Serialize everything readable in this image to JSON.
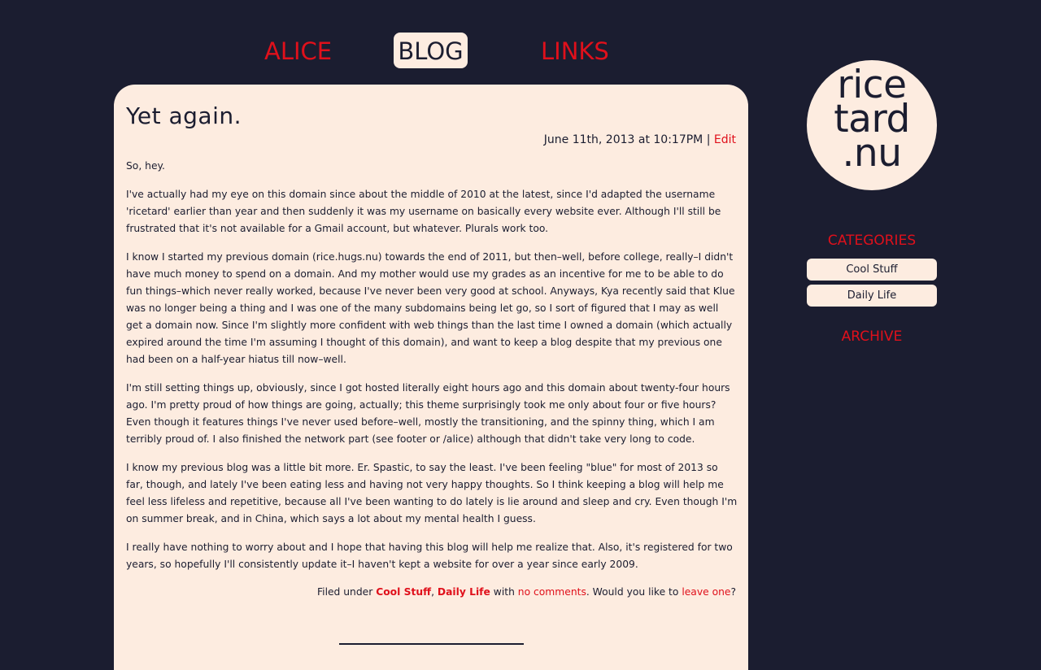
{
  "nav": {
    "alice": "ALICE",
    "blog": "BLOG",
    "links": "LINKS"
  },
  "post": {
    "title": "Yet again.",
    "date": "June 11th, 2013 at 10:17PM",
    "separator": "|",
    "edit_label": "Edit",
    "paragraphs": [
      "So, hey.",
      "I've actually had my eye on this domain since about the middle of 2010 at the latest, since I'd adapted the username 'ricetard' earlier than year and then suddenly it was my username on basically every website ever. Although I'll still be frustrated that it's not available for a Gmail account, but whatever. Plurals work too.",
      "I know I started my previous domain (rice.hugs.nu) towards the end of 2011, but then–well, before college, really–I didn't have much money to spend on a domain. And my mother would use my grades as an incentive for me to be able to do fun things–which never really worked, because I've never been very good at school. Anyways, Kya recently said that Klue was no longer being a thing and I was one of the many subdomains being let go, so I sort of figured that I may as well get a domain now. Since I'm slightly more confident with web things than the last time I owned a domain (which actually expired around the time I'm assuming I thought of this domain), and want to keep a blog despite that my previous one had been on a half-year hiatus till now–well.",
      "I'm still setting things up, obviously, since I got hosted literally eight hours ago and this domain about twenty-four hours ago. I'm pretty proud of how things are going, actually; this theme surprisingly took me only about four or five hours? Even though it features things I've never used before–well, mostly the transitioning, and the spinny thing, which I am terribly proud of. I also finished the network part (see footer or /alice) although that didn't take very long to code.",
      "I know my previous blog was a little bit more. Er. Spastic, to say the least. I've been feeling \"blue\" for most of 2013 so far, though, and lately I've been eating less and having not very happy thoughts. So I think keeping a blog will help me feel less lifeless and repetitive, because all I've been wanting to do lately is lie around and sleep and cry. Even though I'm on summer break, and in China, which says a lot about my mental health I guess.",
      "I really have nothing to worry about and I hope that having this blog will help me realize that. Also, it's registered for two years, so hopefully I'll consistently update it–I haven't kept a website for over a year since early 2009."
    ],
    "footer": {
      "filed_under": "Filed under ",
      "cat1": "Cool Stuff",
      "comma": ", ",
      "cat2": "Daily Life",
      "with": " with ",
      "comments_link": "no comments",
      "question": ". Would you like to ",
      "leave_link": "leave one",
      "qmark": "?"
    }
  },
  "sidebar": {
    "logo_lines": [
      "rice",
      "tard",
      ".nu"
    ],
    "categories_heading": "CATEGORIES",
    "categories": [
      "Cool Stuff",
      "Daily Life"
    ],
    "archive_heading": "ARCHIVE"
  },
  "colors": {
    "background": "#1b1d30",
    "cream": "#fdece0",
    "accent": "#e0101b"
  }
}
